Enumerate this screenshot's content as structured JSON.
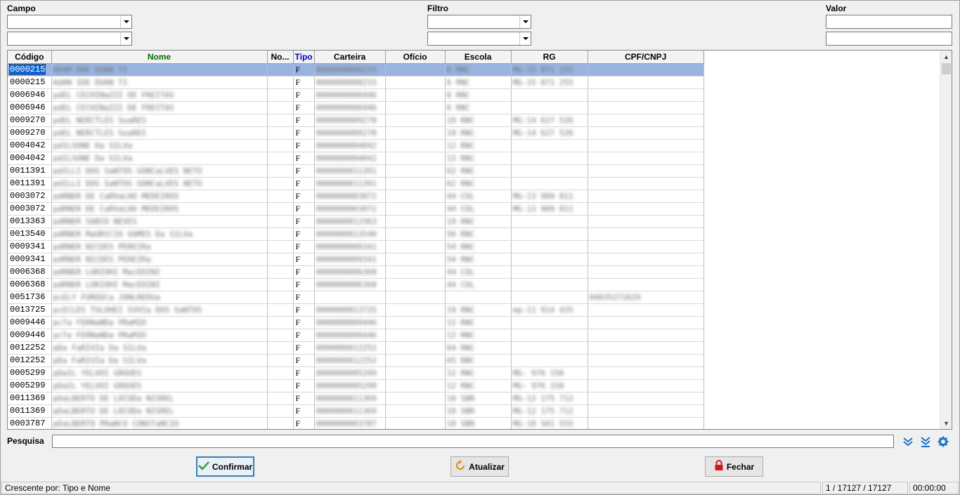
{
  "filters": {
    "campo_label": "Campo",
    "filtro_label": "Filtro",
    "valor_label": "Valor"
  },
  "grid": {
    "columns": [
      "Código",
      "Nome",
      "No...",
      "Tipo",
      "Carteira",
      "Ofício",
      "Escola",
      "RG",
      "CPF/CNPJ"
    ],
    "header_colors": {
      "nome": "#007000",
      "tipo": "#0000c0"
    },
    "rows": [
      {
        "code": "0000215",
        "nome": "ADAM DRE DUAN TI",
        "tipo": "F",
        "carteira": "0000000000215",
        "oficio": "",
        "escola": "6 RNC",
        "rg": "MG-15 871 255",
        "cpf": ""
      },
      {
        "code": "0000215",
        "nome": "AdAN IDE DUAN TI",
        "tipo": "F",
        "carteira": "0000000000215",
        "oficio": "",
        "escola": "6 RNC",
        "rg": "MG-15 871 255",
        "cpf": ""
      },
      {
        "code": "0006946",
        "nome": "pdEL CECHINaZZI DE FREITAS",
        "tipo": "F",
        "carteira": "0000000006946",
        "oficio": "",
        "escola": "6 RNC",
        "rg": "",
        "cpf": ""
      },
      {
        "code": "0006946",
        "nome": "pdEL CECHINaZZI DE FREITAS",
        "tipo": "F",
        "carteira": "0000000006946",
        "oficio": "",
        "escola": "6 RNC",
        "rg": "",
        "cpf": ""
      },
      {
        "code": "0009270",
        "nome": "pdEL NERCTLES SoaRES",
        "tipo": "F",
        "carteira": "0000000009270",
        "oficio": "",
        "escola": "19 RNC",
        "rg": "MG-14 627 526",
        "cpf": ""
      },
      {
        "code": "0009270",
        "nome": "pdEL NERCTLES SoaRES",
        "tipo": "F",
        "carteira": "0000000009270",
        "oficio": "",
        "escola": "19 RNC",
        "rg": "MG-14 627 526",
        "cpf": ""
      },
      {
        "code": "0004042",
        "nome": "pdILSONE Da SILVa",
        "tipo": "F",
        "carteira": "0000000004042",
        "oficio": "",
        "escola": "12 RNC",
        "rg": "",
        "cpf": ""
      },
      {
        "code": "0004042",
        "nome": "pdILSONE Da SILVa",
        "tipo": "F",
        "carteira": "0000000004042",
        "oficio": "",
        "escola": "12 RNC",
        "rg": "",
        "cpf": ""
      },
      {
        "code": "0011391",
        "nome": "pdILLI DOS SaNTOS GONCaLVES NETO",
        "tipo": "F",
        "carteira": "0000000011391",
        "oficio": "",
        "escola": "62 RNC",
        "rg": "",
        "cpf": ""
      },
      {
        "code": "0011391",
        "nome": "pdILLI DOS SaNTOS GONCaLVES NETO",
        "tipo": "F",
        "carteira": "0000000011391",
        "oficio": "",
        "escola": "62 RNC",
        "rg": "",
        "cpf": ""
      },
      {
        "code": "0003072",
        "nome": "pdRNER DE CaRVaLHO MEDEIROS",
        "tipo": "F",
        "carteira": "0000000003072",
        "oficio": "",
        "escola": "44 COL",
        "rg": "MG-13 909 811",
        "cpf": ""
      },
      {
        "code": "0003072",
        "nome": "pdRNER DE CaRVaLHO MEDEIROS",
        "tipo": "F",
        "carteira": "0000000003072",
        "oficio": "",
        "escola": "44 COL",
        "rg": "MG-13 909 811",
        "cpf": ""
      },
      {
        "code": "0013363",
        "nome": "pdRNER SABIO NEVES",
        "tipo": "F",
        "carteira": "0000000013363",
        "oficio": "",
        "escola": "19 RNC",
        "rg": "",
        "cpf": ""
      },
      {
        "code": "0013540",
        "nome": "pdRNER MaURICIO GOMES Da SILVa",
        "tipo": "F",
        "carteira": "0000000013540",
        "oficio": "",
        "escola": "56 RNC",
        "rg": "",
        "cpf": ""
      },
      {
        "code": "0009341",
        "nome": "pdRNER NICDES PEREIRa",
        "tipo": "F",
        "carteira": "0000000009341",
        "oficio": "",
        "escola": "54 RNC",
        "rg": "",
        "cpf": ""
      },
      {
        "code": "0009341",
        "nome": "pdRNER NICDES PEREIRa",
        "tipo": "F",
        "carteira": "0000000009341",
        "oficio": "",
        "escola": "54 RNC",
        "rg": "",
        "cpf": ""
      },
      {
        "code": "0006368",
        "nome": "pdRNER LORIOHI MacEDINI",
        "tipo": "F",
        "carteira": "0000000006368",
        "oficio": "",
        "escola": "44 COL",
        "rg": "",
        "cpf": ""
      },
      {
        "code": "0006368",
        "nome": "pdRNER LORIOHI MacEDINI",
        "tipo": "F",
        "carteira": "0000000006368",
        "oficio": "",
        "escola": "44 COL",
        "rg": "",
        "cpf": ""
      },
      {
        "code": "0051736",
        "nome": "pcELY FUREDCa JONLREDUa",
        "tipo": "F",
        "carteira": "",
        "oficio": "",
        "escola": "",
        "rg": "",
        "cpf": "04035271629"
      },
      {
        "code": "0013725",
        "nome": "pcECLES TULOHEI SVVIa DOS SaNTOS",
        "tipo": "F",
        "carteira": "0000000013725",
        "oficio": "",
        "escola": "19 RNC",
        "rg": "mp-11 914 435",
        "cpf": ""
      },
      {
        "code": "0009446",
        "nome": "pcTa FERNaNDa PRaMID",
        "tipo": "F",
        "carteira": "0000000009446",
        "oficio": "",
        "escola": "12 RNC",
        "rg": "",
        "cpf": ""
      },
      {
        "code": "0009446",
        "nome": "pcTa FERNaNDa PRaMID",
        "tipo": "F",
        "carteira": "0000000009446",
        "oficio": "",
        "escola": "12 RNC",
        "rg": "",
        "cpf": ""
      },
      {
        "code": "0012252",
        "nome": "pDa FaRIVIa Da SILVa",
        "tipo": "F",
        "carteira": "0000000012252",
        "oficio": "",
        "escola": "64 RNC",
        "rg": "",
        "cpf": ""
      },
      {
        "code": "0012252",
        "nome": "pDa FaRIVIa Da SILVa",
        "tipo": "F",
        "carteira": "0000000012252",
        "oficio": "",
        "escola": "65 RNC",
        "rg": "",
        "cpf": ""
      },
      {
        "code": "0005299",
        "nome": "pDaIL YELVOI GROUES",
        "tipo": "F",
        "carteira": "0000000005299",
        "oficio": "",
        "escola": "12 RNC",
        "rg": "MG- 976 156",
        "cpf": ""
      },
      {
        "code": "0005299",
        "nome": "pDaIL YELVOI GROUES",
        "tipo": "F",
        "carteira": "0000000005299",
        "oficio": "",
        "escola": "12 RNC",
        "rg": "MG- 976 156",
        "cpf": ""
      },
      {
        "code": "0011369",
        "nome": "pDaLBERTO DE LOCODa NISREL",
        "tipo": "F",
        "carteira": "0000000011369",
        "oficio": "",
        "escola": "10 SBR",
        "rg": "MG-12 175 712",
        "cpf": ""
      },
      {
        "code": "0011369",
        "nome": "pDaLBERTO DE LOCODa NISREL",
        "tipo": "F",
        "carteira": "0000000011369",
        "oficio": "",
        "escola": "10 SBR",
        "rg": "MG-12 175 712",
        "cpf": ""
      },
      {
        "code": "0003787",
        "nome": "pDaLBERTO PRaNCO CONSTaNCIO",
        "tipo": "F",
        "carteira": "0000000003787",
        "oficio": "",
        "escola": "10 SBR",
        "rg": "MG-10 561 555",
        "cpf": ""
      }
    ]
  },
  "search": {
    "label": "Pesquisa",
    "value": ""
  },
  "icons": {
    "down_all": "double-chevron-down-icon",
    "down_end": "arrow-to-bottom-icon",
    "settings": "gear-icon",
    "confirm": "checkmark-icon",
    "refresh": "refresh-icon",
    "lock": "padlock-icon"
  },
  "buttons": {
    "confirm": "Confirmar",
    "refresh": "Atualizar",
    "close": "Fechar"
  },
  "status": {
    "sort": "Crescente por: Tipo e Nome",
    "records": "1 / 17127 / 17127",
    "time": "00:00:00"
  }
}
